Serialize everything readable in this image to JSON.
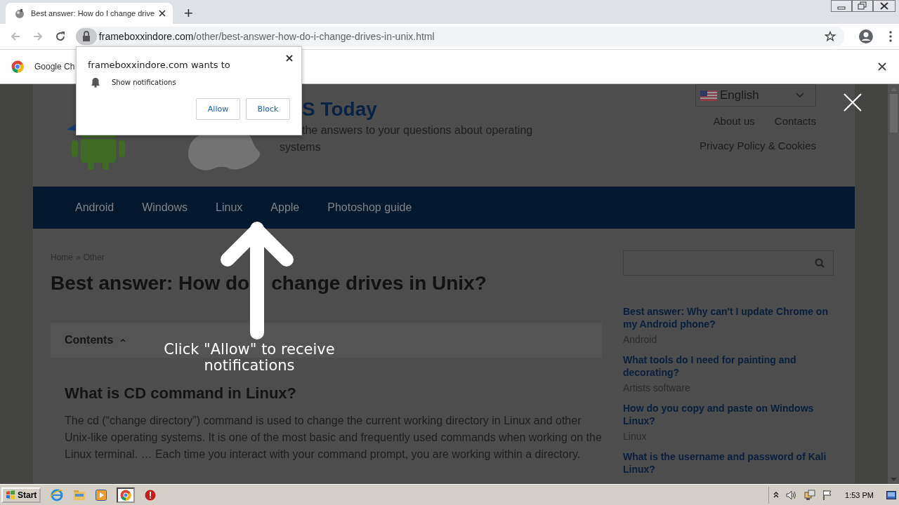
{
  "browser": {
    "tab": {
      "title": "Best answer: How do I change drive",
      "selected": true
    },
    "new_tab": "+",
    "address": {
      "domain": "frameboxxindore.com",
      "path": "/other/best-answer-how-do-i-change-drives-in-unix.html"
    },
    "infobar": {
      "text": "Google Ch"
    }
  },
  "permission_popup": {
    "title": "frameboxxindore.com wants to",
    "permission": "Show notifications",
    "buttons": [
      "Allow",
      "Block"
    ]
  },
  "site": {
    "title": "S Today",
    "tagline": "the answers to your questions about operating systems",
    "language": "English",
    "header_links": [
      "About us",
      "Contacts",
      "Privacy Policy & Cookies"
    ],
    "nav": [
      "Android",
      "Windows",
      "Linux",
      "Apple",
      "Photoshop guide"
    ],
    "breadcrumb": {
      "items": [
        "Home",
        "Other"
      ],
      "separator": "»"
    },
    "heading": "Best answer: How do    change drives in Unix?",
    "contents": {
      "label": "Contents",
      "expanded": true
    },
    "section_heading": "What is CD command in Linux?",
    "paragraph": "The cd (“change directory”) command is used to change the current working directory in Linux and other Unix-like operating systems. It is one of the most basic and frequently used commands when working on the Linux terminal. … Each time you interact with your command prompt, you are working within a directory.",
    "sidebar": {
      "articles": [
        {
          "title": "Best answer: Why can't I update Chrome on my Android phone?",
          "category": "Android"
        },
        {
          "title": "What tools do I need for painting and decorating?",
          "category": "Artists software"
        },
        {
          "title": "How do you copy and paste on Windows Linux?",
          "category": "Linux"
        },
        {
          "title": "What is the username and password of Kali Linux?"
        }
      ]
    }
  },
  "overlay": {
    "hint": "Click \"Allow\" to receive notifications"
  },
  "taskbar": {
    "start": "Start",
    "clock": "1:53 PM"
  }
}
